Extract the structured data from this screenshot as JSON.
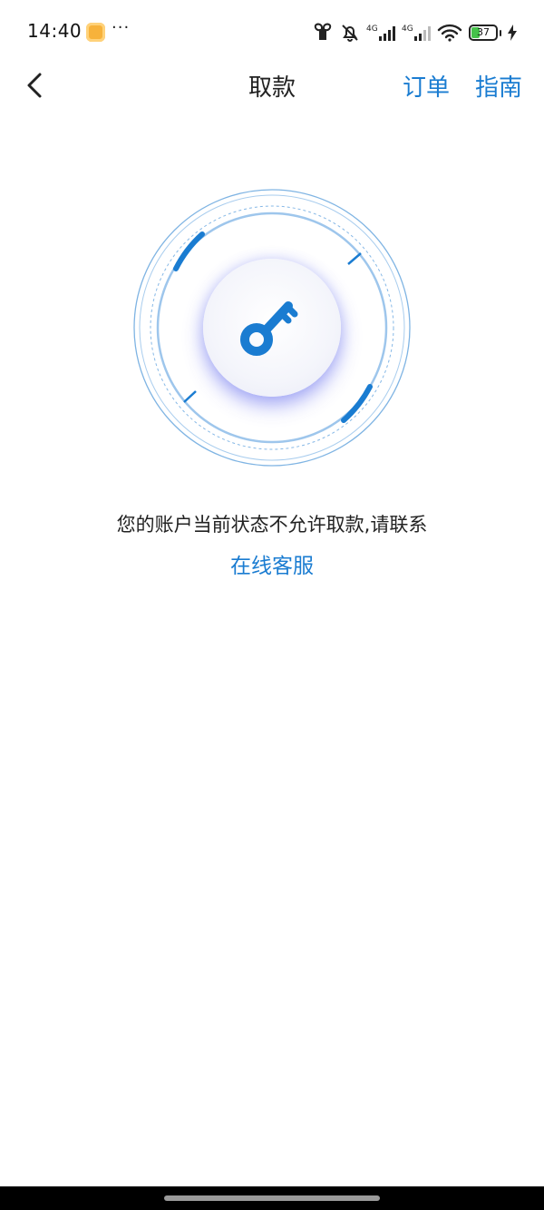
{
  "status_bar": {
    "time": "14:40",
    "app_icon": "notes-app-icon",
    "more": "···",
    "network_1": "4G",
    "network_2": "4G",
    "battery": "37"
  },
  "nav": {
    "back_icon": "chevron-left-icon",
    "title": "取款",
    "orders_label": "订单",
    "guide_label": "指南"
  },
  "illustration": {
    "icon": "key-icon",
    "accent_color": "#1a7cd1"
  },
  "message": {
    "text": "您的账户当前状态不允许取款,请联系",
    "link_label": "在线客服"
  },
  "colors": {
    "brand": "#1a7cd1",
    "battery_fill": "#45c24a",
    "text": "#222222"
  }
}
